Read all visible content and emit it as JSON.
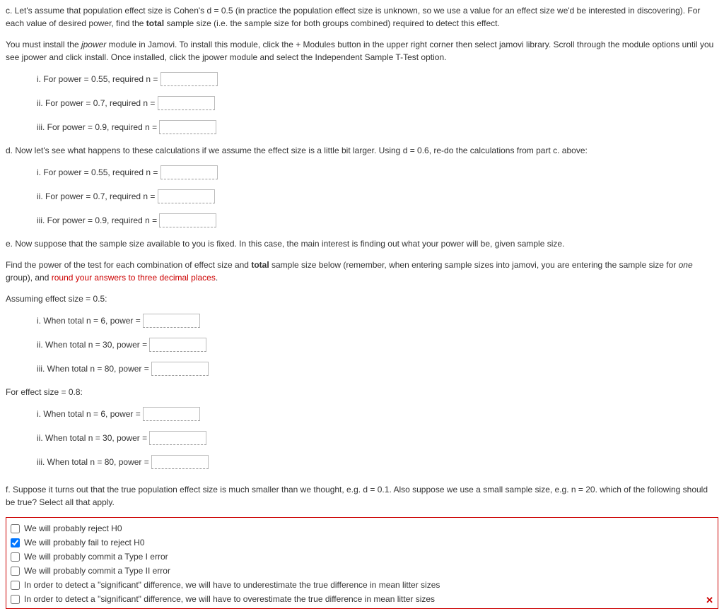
{
  "partC": {
    "intro1": "c. Let's assume that population effect size is Cohen's d = 0.5 (in practice the population effect size is unknown, so we use a value for an effect size we'd be interested in discovering). For each value of desired power, find the ",
    "introBold": "total",
    "intro2": " sample size (i.e. the sample size for both groups combined) required to detect this effect.",
    "install1": "You must install the ",
    "installItalic": "jpower",
    "install2": " module in Jamovi. To install this module, click the + Modules button in the upper right corner then select jamovi library. Scroll through the module options until you see jpower and click install. Once installed, click the jpower module and select the Independent Sample T-Test option.",
    "items": [
      "i. For power = 0.55, required n = ",
      "ii. For power = 0.7, required n = ",
      "iii. For power = 0.9, required n = "
    ]
  },
  "partD": {
    "intro": "d. Now let's see what happens to these calculations if we assume the effect size is a little bit larger. Using d = 0.6, re-do the calculations from part c. above:",
    "items": [
      "i. For power = 0.55, required n = ",
      "ii. For power = 0.7, required n = ",
      "iii. For power = 0.9, required n = "
    ]
  },
  "partE": {
    "intro": "e. Now suppose that the sample size available to you is fixed. In this case, the main interest is finding out what your power will be, given sample size.",
    "find1": "Find the power of the test for each combination of effect size and ",
    "findBold": "total",
    "find2": " sample size below (remember, when entering sample sizes into jamovi, you are entering the sample size for ",
    "findItalic": "one",
    "find3": " group), and ",
    "findRed": "round your answers to three decimal places",
    "find4": ".",
    "group1Header": "Assuming effect size = 0.5:",
    "group1": [
      "i. When total n = 6, power = ",
      "ii. When total n = 30, power = ",
      "iii. When total n = 80, power = "
    ],
    "group2Header": "For effect size = 0.8:",
    "group2": [
      "i. When total n = 6, power = ",
      "ii. When total n = 30, power = ",
      "iii. When total n = 80, power = "
    ]
  },
  "partF": {
    "intro": "f. Suppose it turns out that the true population effect size is much smaller than we thought, e.g. d = 0.1. Also suppose we use a small sample size, e.g. n = 20. which of the following should be true? Select all that apply.",
    "options": [
      "We will probably reject H0",
      "We will probably fail to reject H0",
      "We will probably commit a Type I error",
      "We will probably commit a Type II error",
      "In order to detect a \"significant\" difference, we will have to underestimate the true difference in mean litter sizes",
      "In order to detect a \"significant\" difference, we will have to overestimate the true difference in mean litter sizes"
    ],
    "xmark": "✕"
  }
}
